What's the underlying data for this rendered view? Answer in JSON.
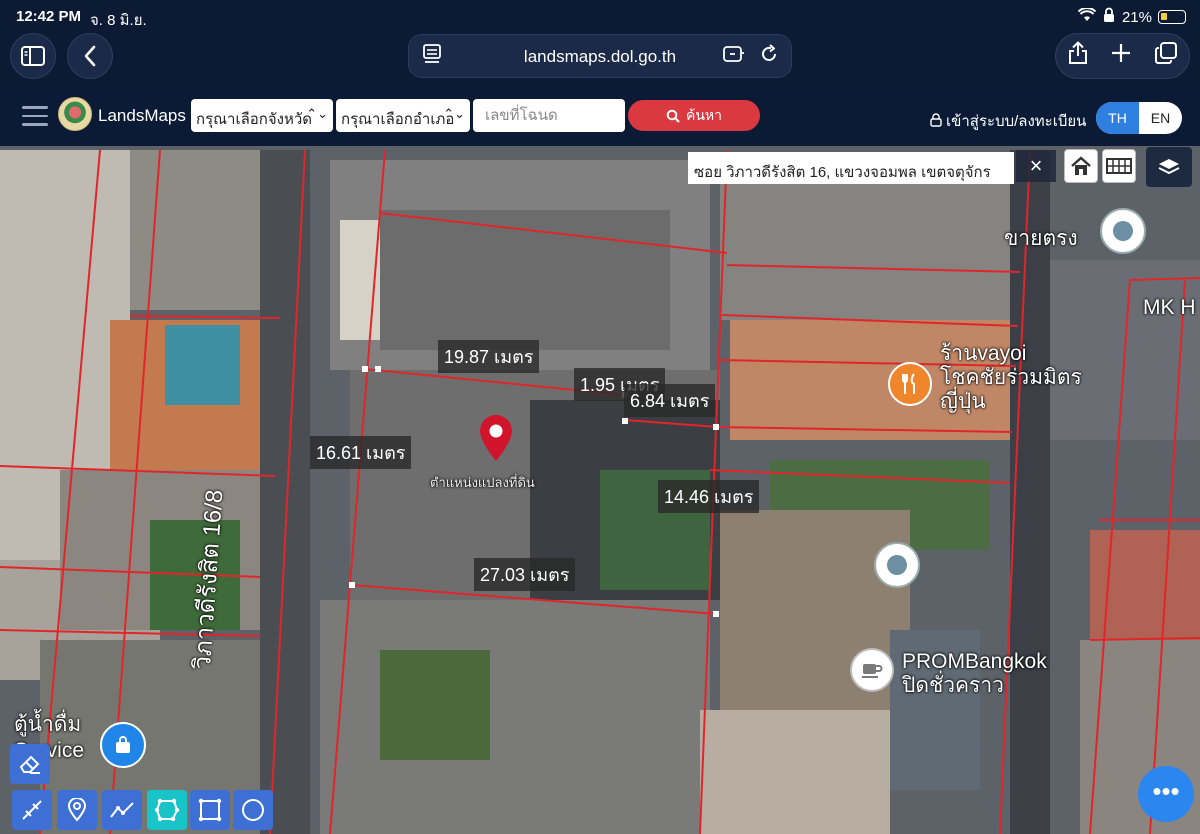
{
  "status_bar": {
    "time": "12:42 PM",
    "date": "จ. 8 มิ.ย.",
    "battery": "21%"
  },
  "browser": {
    "url": "landsmaps.dol.go.th"
  },
  "header": {
    "brand": "LandsMaps",
    "province_select": "กรุณาเลือกจังหวัด",
    "district_select": "กรุณาเลือกอำเภอ",
    "deed_placeholder": "เลขที่โฉนด",
    "search_label": "ค้นหา",
    "login_label": "เข้าสู่ระบบ/ลงทะเบียน",
    "lang_th": "TH",
    "lang_en": "EN"
  },
  "map": {
    "address": "ซอย วิภาวดีรังสิต 16, แขวงจอมพล เขตจตุจักร",
    "street_label": "วิภาวดีรังสิต 16/8",
    "parcel_label": "ตำแหน่งแปลงที่ดิน",
    "measurements": [
      "19.87 เมตร",
      "1.95 เมตร",
      "6.84 เมตร",
      "16.61 เมตร",
      "14.46 เมตร",
      "27.03 เมตร"
    ],
    "pois": {
      "direct_sale": "ขายตรง",
      "mk": "MK H",
      "restaurant_line1": "ร้านvayoi",
      "restaurant_line2": "โชคชัยร่วมมิตร",
      "restaurant_line3": "ญี่ปุ่น",
      "cafe_line1": "PROMBangkok",
      "cafe_line2": "ปิดชั่วคราว",
      "water_line1": "ตู้น้ำดื่ม",
      "water_line2": "Service"
    }
  },
  "colors": {
    "accent": "#2f7fe0",
    "search": "#d9393f",
    "parcel_line": "#e0262b",
    "pin": "#d0142c"
  }
}
